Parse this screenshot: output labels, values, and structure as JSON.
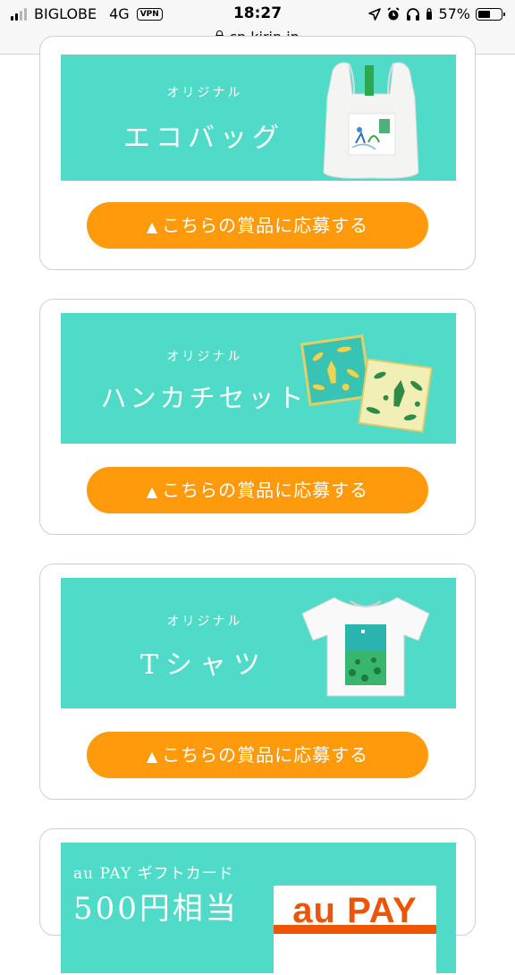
{
  "status_bar": {
    "carrier": "BIGLOBE",
    "network": "4G",
    "vpn": "VPN",
    "time": "18:27",
    "battery": "57%",
    "battery_level": 0.57,
    "url": "cp.kirin.jp"
  },
  "prizes": [
    {
      "subtitle": "オリジナル",
      "title": "エコバッグ",
      "button": "こちらの賞品に応募する"
    },
    {
      "subtitle": "オリジナル",
      "title": "ハンカチセット",
      "button": "こちらの賞品に応募する"
    },
    {
      "subtitle": "オリジナル",
      "title": "Tシャツ",
      "button": "こちらの賞品に応募する"
    },
    {
      "subtitle": "au PAY ギフトカード",
      "title": "500円相当",
      "logo_text": "au PAY"
    }
  ],
  "colors": {
    "banner": "#4fdbc8",
    "button": "#ff9a0c",
    "au_orange": "#eb5505"
  },
  "icons": {
    "button_marker": "triangle-up-icon"
  }
}
